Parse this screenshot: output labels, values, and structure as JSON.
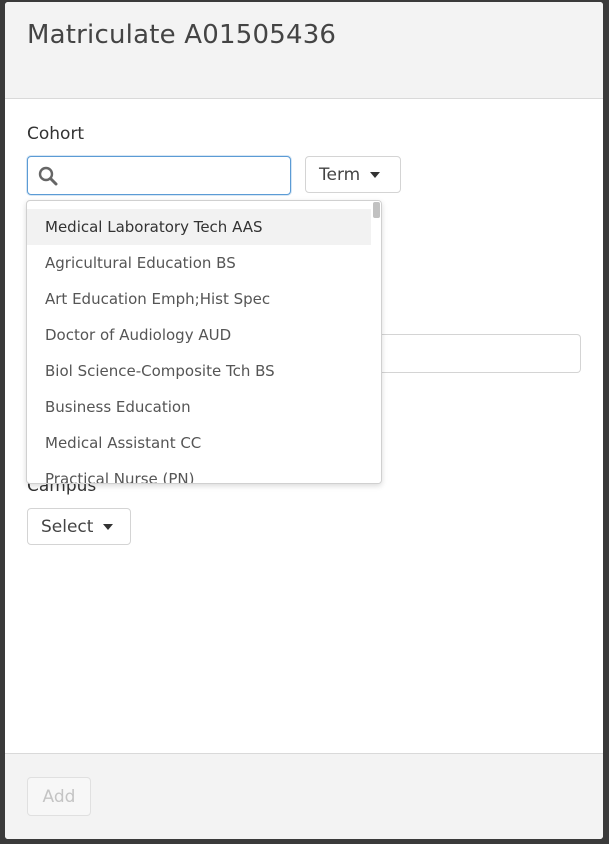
{
  "modal": {
    "title": "Matriculate A01505436"
  },
  "form": {
    "cohort_label": "Cohort",
    "search": {
      "value": "",
      "placeholder": ""
    },
    "term_select": {
      "label": "Term"
    },
    "campus_label": "Campus",
    "campus_select": {
      "label": "Select"
    }
  },
  "dropdown": {
    "items": [
      "Medical Laboratory Tech AAS",
      "Agricultural Education BS",
      "Art Education Emph;Hist Spec",
      "Doctor of Audiology AUD",
      "Biol Science-Composite Tch BS",
      "Business Education",
      "Medical Assistant CC",
      "Practical Nurse (PN)"
    ],
    "highlighted_index": 0
  },
  "footer": {
    "add_label": "Add"
  },
  "icons": {
    "search": "search-icon",
    "term_caret": "caret-down-icon",
    "campus_caret": "caret-down-icon"
  }
}
